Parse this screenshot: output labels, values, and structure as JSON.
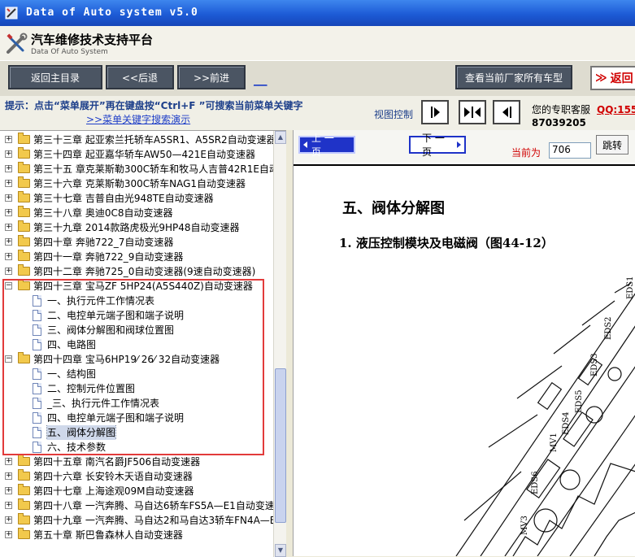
{
  "window": {
    "title": "Data of Auto system v5.0"
  },
  "header": {
    "title": "汽车维修技术支持平台",
    "subtitle": "Data Of Auto System"
  },
  "toolbar": {
    "home": "返回主目录",
    "back": "<<后退",
    "forward": ">>前进",
    "link": "___",
    "view_all": "查看当前厂家所有车型",
    "return": "返回"
  },
  "hint": {
    "text": "提示：点击“菜单展开”再在键盘按“Ctrl+F ”可搜索当前菜单关键字",
    "demo_link": ">>菜单关键字搜索演示",
    "view_control": "视图控制"
  },
  "service": {
    "label": "您的专职客服",
    "qq": "QQ:155",
    "number": "87039205"
  },
  "tree": {
    "chapters_a": [
      "第三十三章 起亚索兰托轿车A5SR1、A5SR2自动变速器",
      "第三十四章 起亚嘉华轿车AW50—421E自动变速器",
      "第三十五 章克莱斯勒300C轿车和牧马人吉普42R1E自动",
      "第三十六章 克莱斯勒300C轿车NAG1自动变速器",
      "第三十七章 吉普自由光948TE自动变速器",
      "第三十八章 奥迪0C8自动变速器",
      "第三十九章 2014款路虎极光9HP48自动变速器",
      "第四十章 奔驰722_7自动变速器",
      "第四十一章 奔驰722_9自动变速器",
      "第四十二章 奔驰725_0自动变速器(9速自动变速器)"
    ],
    "ch43": {
      "title": "第四十三章 宝马ZF 5HP24(A5S440Z)自动变速器",
      "items": [
        "一、执行元件工作情况表",
        "二、电控单元端子图和端子说明",
        "三、阀体分解图和阀球位置图",
        "四、电路图"
      ]
    },
    "ch44": {
      "title": "第四十四章 宝马6HP19⁄ 26⁄ 32自动变速器",
      "items": [
        "一、结构图",
        "二、控制元件位置图",
        "_三、执行元件工作情况表",
        "四、电控单元端子图和端子说明",
        "五、阀体分解图",
        "六、技术参数"
      ]
    },
    "chapters_b": [
      "第四十五章 南汽名爵JF506自动变速器",
      "第四十六章 长安铃木天语自动变速器",
      "第四十七章 上海途观09M自动变速器",
      "第四十八章 一汽奔腾、马自达6轿车FS5A—E1自动变速",
      "第四十九章 一汽奔腾、马自达2和马自达3轿车FN4A—E",
      "第五十章 斯巴鲁森林人自动变速器"
    ]
  },
  "doc": {
    "prev": "上 一 页",
    "next": "下 一 页",
    "current_label": "当前为",
    "page": "706",
    "jump": "跳转",
    "heading": "五、阀体分解图",
    "subheading": "1. 液压控制模块及电磁阀（图44-12）",
    "labels": [
      "EDS1",
      "EDS2",
      "EDS3",
      "EDS5",
      "EDS4",
      "MV1",
      "EDS6",
      "MV3"
    ]
  }
}
